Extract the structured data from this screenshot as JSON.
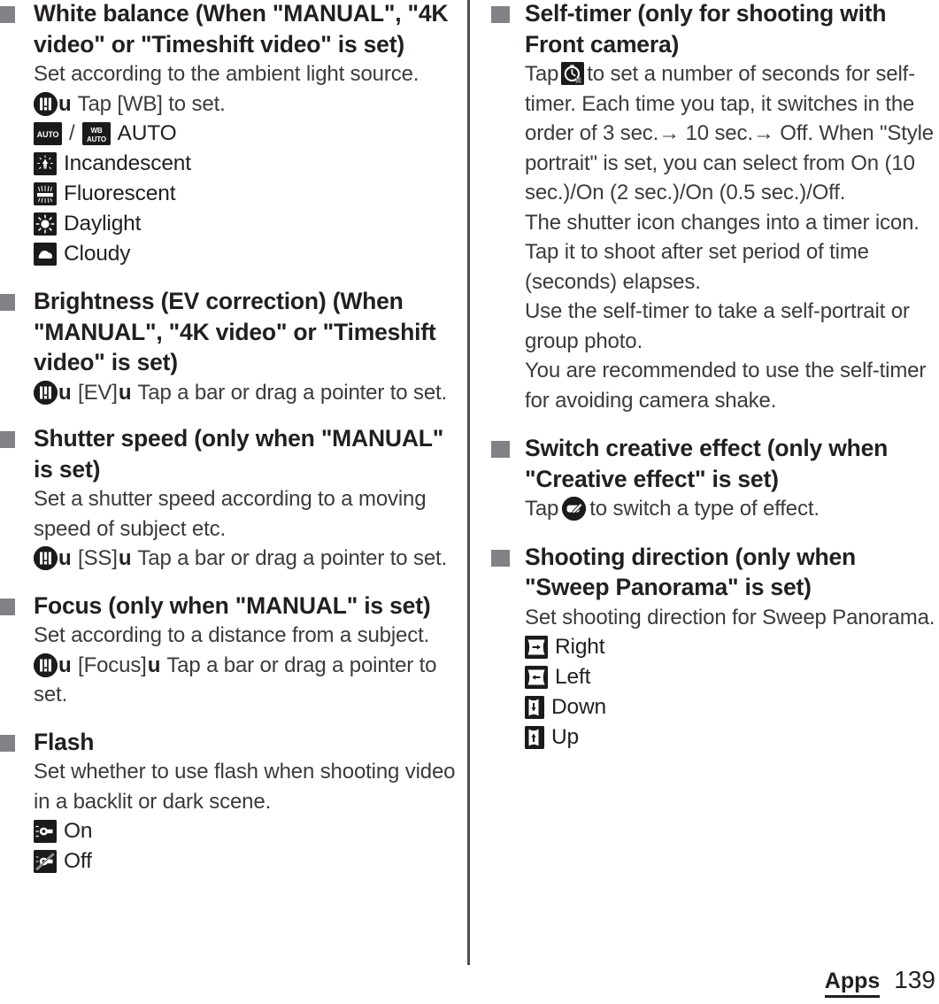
{
  "document": {
    "footer": {
      "chapter": "Apps",
      "page_number": "139"
    }
  },
  "left_column": {
    "sections": [
      {
        "id": "white-balance",
        "heading": "White balance (When \"MANUAL\", \"4K video\" or \"Timeshift video\" is set)",
        "body_1": "Set according to the ambient light source.",
        "steps_prefix": "u",
        "steps_text": "Tap [WB] to set.",
        "options": [
          {
            "label": "AUTO",
            "icon": "wb-auto-icon",
            "icon_text": "AUTO",
            "icon_text_2": "WB AUTO",
            "has_pair": true,
            "separator": "/"
          },
          {
            "label": "Incandescent",
            "icon": "incandescent-icon"
          },
          {
            "label": "Fluorescent",
            "icon": "fluorescent-icon"
          },
          {
            "label": "Daylight",
            "icon": "daylight-icon"
          },
          {
            "label": "Cloudy",
            "icon": "cloudy-icon"
          }
        ]
      },
      {
        "id": "brightness-ev",
        "heading": "Brightness (EV correction) (When \"MANUAL\", \"4K video\" or \"Timeshift video\" is set)",
        "step_line": {
          "arrow_1": "u",
          "token": "[EV]",
          "arrow_2": "u",
          "text": "Tap a bar or drag a pointer to set."
        }
      },
      {
        "id": "shutter-speed",
        "heading": "Shutter speed (only when \"MANUAL\" is set)",
        "body_1": "Set a shutter speed according to a moving speed of subject etc.",
        "step_line": {
          "arrow_1": "u",
          "token": "[SS]",
          "arrow_2": "u",
          "text": "Tap a bar or drag a pointer to set."
        }
      },
      {
        "id": "focus",
        "heading": "Focus (only when \"MANUAL\" is set)",
        "body_1": "Set according to a distance from a subject.",
        "step_line": {
          "arrow_1": "u",
          "token": "[Focus]",
          "arrow_2": "u",
          "text": "Tap a bar or drag a pointer to set."
        }
      },
      {
        "id": "flash",
        "heading": "Flash",
        "body_1": "Set whether to use flash when shooting video in a backlit or dark scene.",
        "options": [
          {
            "label": "On",
            "icon": "flash-on-icon"
          },
          {
            "label": "Off",
            "icon": "flash-off-icon"
          }
        ]
      }
    ]
  },
  "right_column": {
    "sections": [
      {
        "id": "self-timer",
        "heading": "Self-timer (only for shooting with Front camera)",
        "body_before_icon": "Tap",
        "body_after_icon": "to set a number of seconds for self-timer. Each time you tap, it switches in the order of 3 sec.→ 10 sec.→ Off. When \"Style portrait\" is set, you can select from On (10 sec.)/On (2 sec.)/On (0.5 sec.)/Off.",
        "body_2": "The shutter icon changes into a timer icon. Tap it to shoot after set period of time (seconds) elapses.",
        "body_3": "Use the self-timer to take a self-portrait or group photo.",
        "body_4": "You are recommended to use the self-timer for avoiding camera shake."
      },
      {
        "id": "switch-creative-effect",
        "heading": "Switch creative effect (only when \"Creative effect\" is set)",
        "body_before_icon": "Tap",
        "body_after_icon": "to switch a type of effect."
      },
      {
        "id": "shooting-direction",
        "heading": "Shooting direction (only when \"Sweep Panorama\" is set)",
        "body_1": "Set shooting direction for Sweep Panorama.",
        "options": [
          {
            "label": "Right",
            "icon": "panorama-right-icon"
          },
          {
            "label": "Left",
            "icon": "panorama-left-icon"
          },
          {
            "label": "Down",
            "icon": "panorama-down-icon"
          },
          {
            "label": "Up",
            "icon": "panorama-up-icon"
          }
        ]
      }
    ]
  }
}
